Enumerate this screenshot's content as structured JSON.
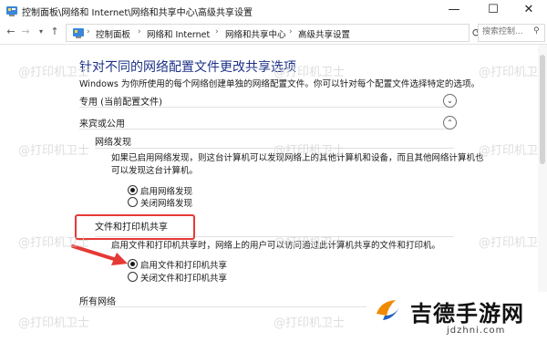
{
  "window": {
    "title": "控制面板\\网络和 Internet\\网络和共享中心\\高级共享设置",
    "controls": {
      "minimize": "—",
      "maximize": "☐",
      "close": "✕"
    }
  },
  "address": {
    "crumbs": [
      "控制面板",
      "网络和 Internet",
      "网络和共享中心",
      "高级共享设置"
    ],
    "search_placeholder": "搜索控制..."
  },
  "page": {
    "heading": "针对不同的网络配置文件更改共享选项",
    "description": "Windows 为你所使用的每个网络创建单独的网络配置文件。你可以针对每个配置文件选择特定的选项。",
    "private_profile": "专用 (当前配置文件)",
    "guest_profile": "来宾或公用",
    "network_discovery": {
      "title": "网络发现",
      "desc_line1": "如果已启用网络发现，则这台计算机可以发现网络上的其他计算机和设备，而且其他网络计算机也",
      "desc_line2": "可以发现这台计算机。",
      "options": [
        {
          "label": "启用网络发现",
          "selected": true
        },
        {
          "label": "关闭网络发现",
          "selected": false
        }
      ]
    },
    "file_sharing": {
      "title": "文件和打印机共享",
      "desc": "启用文件和打印机共享时，网络上的用户可以访问通过此计算机共享的文件和打印机。",
      "options": [
        {
          "label": "启用文件和打印机共享",
          "selected": true
        },
        {
          "label": "关闭文件和打印机共享",
          "selected": false
        }
      ]
    },
    "all_networks": "所有网络"
  },
  "watermark_text": "@打印机卫士",
  "logo": {
    "brand": "吉德手游网",
    "domain": "jdzhni.com"
  },
  "colors": {
    "heading": "#1e3287",
    "highlight": "#e53935",
    "logo_orange": "#f08a00",
    "logo_blue": "#1f5fbf"
  }
}
